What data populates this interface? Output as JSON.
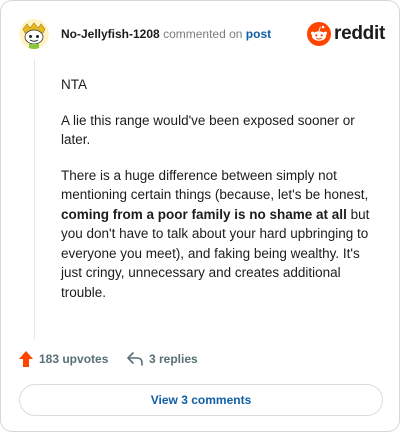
{
  "comment": {
    "username": "No-Jellyfish-1208",
    "verb": "commented on",
    "target": "post",
    "paragraphs": [
      {
        "parts": [
          {
            "text": "NTA",
            "bold": false
          }
        ]
      },
      {
        "parts": [
          {
            "text": "A lie this range would've been exposed sooner or later.",
            "bold": false
          }
        ]
      },
      {
        "parts": [
          {
            "text": "There is a huge difference between simply not mentioning certain things (because, let's be honest, ",
            "bold": false
          },
          {
            "text": "coming from a poor family is no shame at all",
            "bold": true
          },
          {
            "text": " but you don't have to talk about your hard upbringing to everyone you meet), and faking being wealthy. It's just cringy, unnecessary and creates additional trouble.",
            "bold": false
          }
        ]
      }
    ]
  },
  "brand": {
    "name": "reddit",
    "icon": "reddit-logo-icon",
    "color": "#ff4500"
  },
  "actions": {
    "upvotes_label": "183 upvotes",
    "upvote_icon": "upvote-arrow-icon",
    "upvote_color": "#ff4500",
    "replies_label": "3 replies",
    "reply_icon": "reply-arrow-icon"
  },
  "view_button_label": "View 3 comments",
  "colors": {
    "link": "#0f5fa6",
    "muted": "#7c7c7c"
  },
  "avatar": {
    "icon": "snoo-avatar-icon"
  }
}
